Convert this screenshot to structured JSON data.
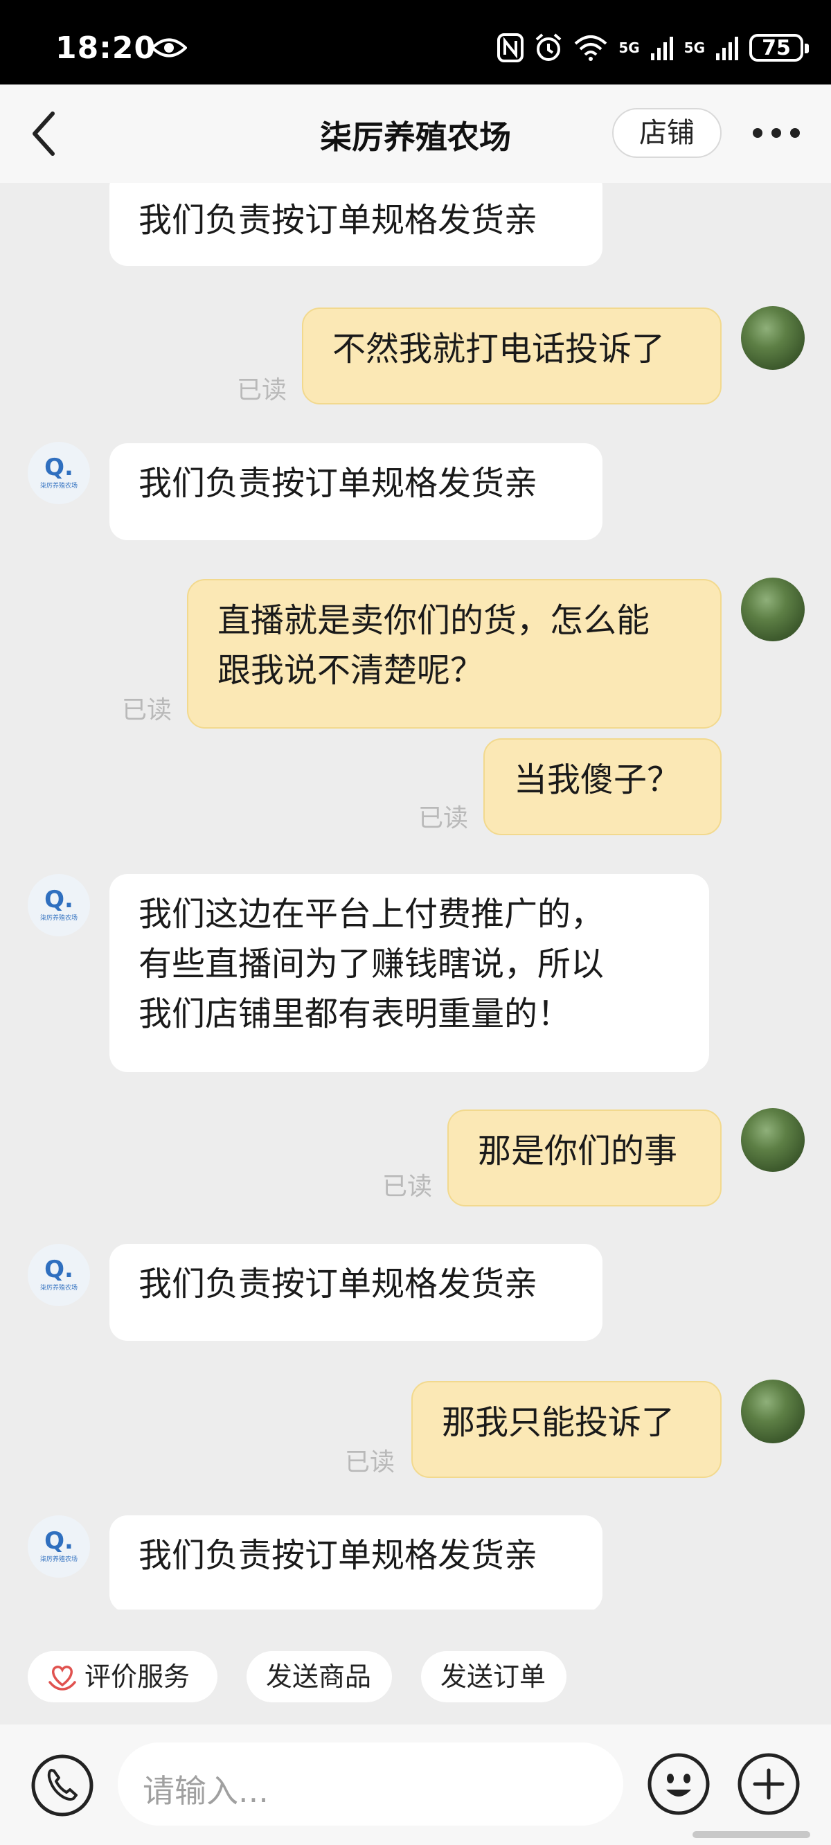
{
  "status_bar": {
    "time": "18:20",
    "net1": "5G",
    "net2": "5G",
    "battery": "75",
    "icons": [
      "eye-icon",
      "nfc-icon",
      "alarm-icon",
      "wifi-icon",
      "signal-icon",
      "signal-icon"
    ]
  },
  "nav": {
    "title": "柒厉养殖农场",
    "shop_label": "店铺"
  },
  "shop_avatar": {
    "letter": "Q.",
    "text": "柒厉养殖农场"
  },
  "messages": [
    {
      "side": "in",
      "text": "我们负责按订单规格发货亲"
    },
    {
      "side": "out",
      "text": "不然我就打电话投诉了",
      "read": "已读"
    },
    {
      "side": "in",
      "text": "我们负责按订单规格发货亲"
    },
    {
      "side": "out",
      "text": "直播就是卖你们的货，怎么能\n跟我说不清楚呢？",
      "read": "已读"
    },
    {
      "side": "out",
      "text": "当我傻子？",
      "read": "已读"
    },
    {
      "side": "in",
      "text": "我们这边在平台上付费推广的，\n有些直播间为了赚钱瞎说，所以\n我们店铺里都有表明重量的！"
    },
    {
      "side": "out",
      "text": "那是你们的事",
      "read": "已读"
    },
    {
      "side": "in",
      "text": "我们负责按订单规格发货亲"
    },
    {
      "side": "out",
      "text": "那我只能投诉了",
      "read": "已读"
    },
    {
      "side": "in",
      "text": "我们负责按订单规格发货亲"
    }
  ],
  "quick_actions": [
    {
      "label": "评价服务",
      "icon": "heart-hand-icon"
    },
    {
      "label": "发送商品"
    },
    {
      "label": "发送订单"
    }
  ],
  "input": {
    "placeholder": "请输入..."
  },
  "colors": {
    "incoming_bubble": "#ffffff",
    "outgoing_bubble": "#fbe8b5",
    "background": "#ededed"
  }
}
